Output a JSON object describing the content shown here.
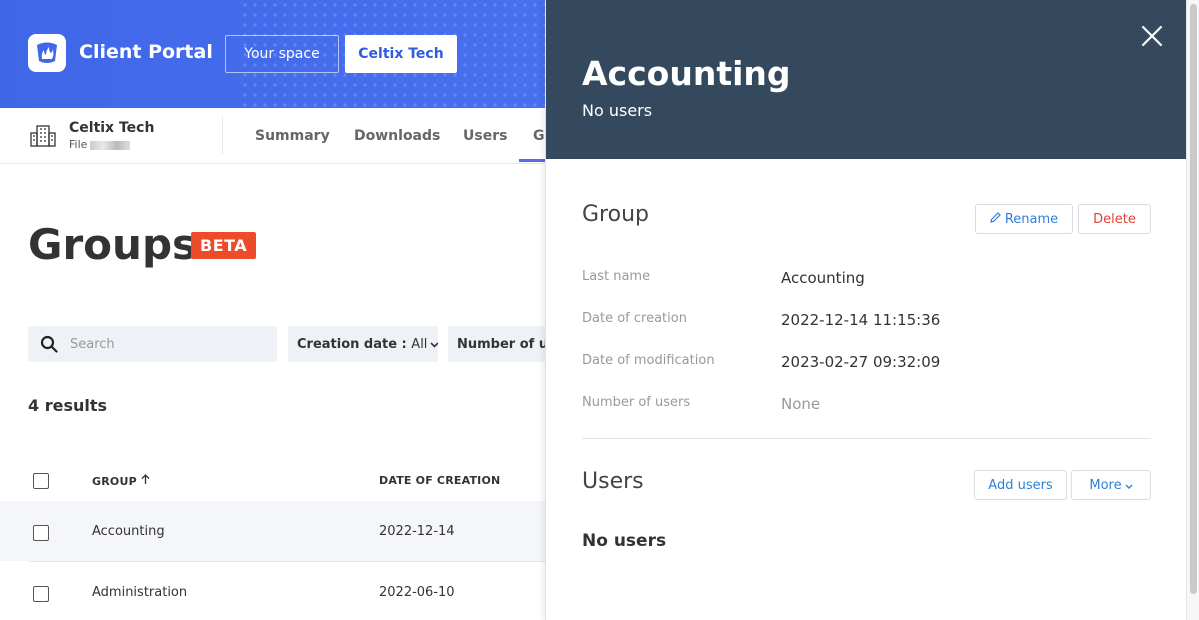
{
  "header": {
    "app_title": "Client Portal",
    "your_space_label": "Your space",
    "company_button_label": "Celtix Tech"
  },
  "company": {
    "name": "Celtix Tech",
    "file_label": "File"
  },
  "nav": {
    "tabs": [
      {
        "label": "Summary"
      },
      {
        "label": "Downloads"
      },
      {
        "label": "Users"
      },
      {
        "label": "G"
      }
    ]
  },
  "page": {
    "title": "Groups",
    "badge": "BETA",
    "search_placeholder": "Search",
    "filters": [
      {
        "label": "Creation date :",
        "value": "All"
      },
      {
        "label": "Number of use",
        "value": ""
      }
    ],
    "results": "4 results"
  },
  "table": {
    "headers": [
      "GROUP",
      "DATE OF CREATION"
    ],
    "rows": [
      {
        "group": "Accounting",
        "date": "2022-12-14"
      },
      {
        "group": "Administration",
        "date": "2022-06-10"
      }
    ]
  },
  "drawer": {
    "title": "Accounting",
    "subtitle": "No users",
    "group_section": {
      "title": "Group",
      "rename_label": "Rename",
      "delete_label": "Delete",
      "fields": [
        {
          "label": "Last name",
          "value": "Accounting"
        },
        {
          "label": "Date of creation",
          "value": "2022-12-14 11:15:36"
        },
        {
          "label": "Date of modification",
          "value": "2023-02-27 09:32:09"
        },
        {
          "label": "Number of users",
          "value": "None"
        }
      ]
    },
    "users_section": {
      "title": "Users",
      "add_users_label": "Add users",
      "more_label": "More",
      "empty_text": "No users"
    }
  },
  "colors": {
    "header_blue": "#4a72f0",
    "drawer_header": "#34495e",
    "beta_badge": "#ee4b2b",
    "link_blue": "#2f7fd8",
    "danger_red": "#e0403a"
  }
}
